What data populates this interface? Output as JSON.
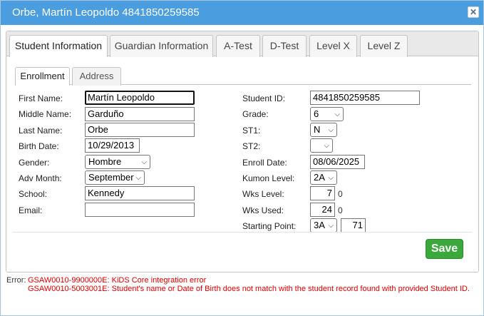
{
  "dialog": {
    "title": "Orbe, Martín Leopoldo 4841850259585",
    "close_symbol": "✕"
  },
  "tabs": [
    {
      "label": "Student Information",
      "active": true
    },
    {
      "label": "Guardian Information",
      "active": false
    },
    {
      "label": "A-Test",
      "active": false
    },
    {
      "label": "D-Test",
      "active": false
    },
    {
      "label": "Level X",
      "active": false
    },
    {
      "label": "Level Z",
      "active": false
    }
  ],
  "subtabs": [
    {
      "label": "Enrollment",
      "active": true
    },
    {
      "label": "Address",
      "active": false
    }
  ],
  "form": {
    "first_name": {
      "label": "First Name:",
      "value": "Martín Leopoldo"
    },
    "middle_name": {
      "label": "Middle Name:",
      "value": "Garduño"
    },
    "last_name": {
      "label": "Last Name:",
      "value": "Orbe"
    },
    "birth_date": {
      "label": "Birth Date:",
      "value": "10/29/2013"
    },
    "gender": {
      "label": "Gender:",
      "value": "Hombre"
    },
    "adv_month": {
      "label": "Adv Month:",
      "value": "September"
    },
    "school": {
      "label": "School:",
      "value": "Kennedy"
    },
    "email": {
      "label": "Email:",
      "value": ""
    },
    "student_id": {
      "label": "Student ID:",
      "value": "4841850259585"
    },
    "grade": {
      "label": "Grade:",
      "value": "6"
    },
    "st1": {
      "label": "ST1:",
      "value": "N"
    },
    "st2": {
      "label": "ST2:",
      "value": ""
    },
    "enroll_date": {
      "label": "Enroll Date:",
      "value": "08/06/2025"
    },
    "kumon_level": {
      "label": "Kumon Level:",
      "value": "2A"
    },
    "wks_level": {
      "label": "Wks Level:",
      "value": "7",
      "aux": "0"
    },
    "wks_used": {
      "label": "Wks Used:",
      "value": "24",
      "aux": "0"
    },
    "starting_point": {
      "label": "Starting Point:",
      "level": "3A",
      "value": "71"
    }
  },
  "save_label": "Save",
  "errors": {
    "label": "Error:",
    "lines": [
      "GSAW0010-9900000E: KiDS Core integration error",
      "GSAW0010-5003001E: Student's name or Date of Birth does not match with the student record found with provided Student ID."
    ]
  },
  "colors": {
    "titlebar": "#4a9ee0",
    "save_button": "#3aa83a",
    "error_text": "#e00000"
  }
}
